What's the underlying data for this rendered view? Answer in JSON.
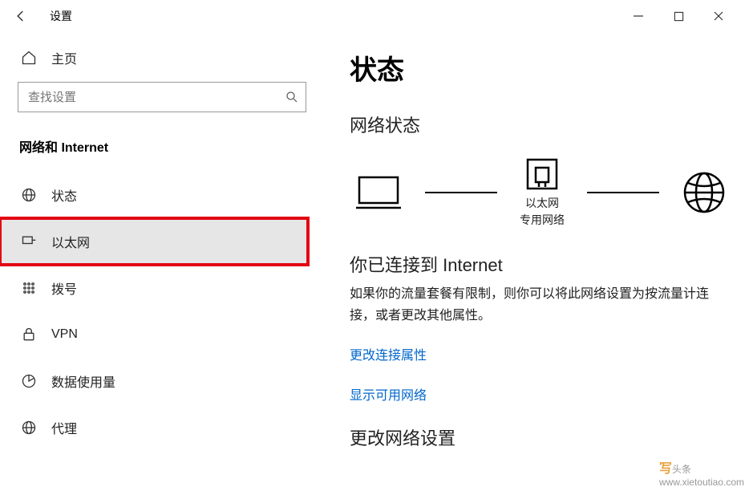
{
  "titlebar": {
    "title": "设置"
  },
  "sidebar": {
    "home": "主页",
    "search_placeholder": "查找设置",
    "section": "网络和 Internet",
    "items": [
      {
        "label": "状态"
      },
      {
        "label": "以太网"
      },
      {
        "label": "拨号"
      },
      {
        "label": "VPN"
      },
      {
        "label": "数据使用量"
      },
      {
        "label": "代理"
      }
    ]
  },
  "main": {
    "heading": "状态",
    "subheading": "网络状态",
    "diagram": {
      "center1": "以太网",
      "center2": "专用网络"
    },
    "connected_title": "你已连接到 Internet",
    "connected_desc": "如果你的流量套餐有限制，则你可以将此网络设置为按流量计连接，或者更改其他属性。",
    "link1": "更改连接属性",
    "link2": "显示可用网络",
    "change_settings": "更改网络设置"
  },
  "watermark": {
    "brand": "写",
    "text": "头条",
    "url": "www.xietoutiao.com"
  }
}
